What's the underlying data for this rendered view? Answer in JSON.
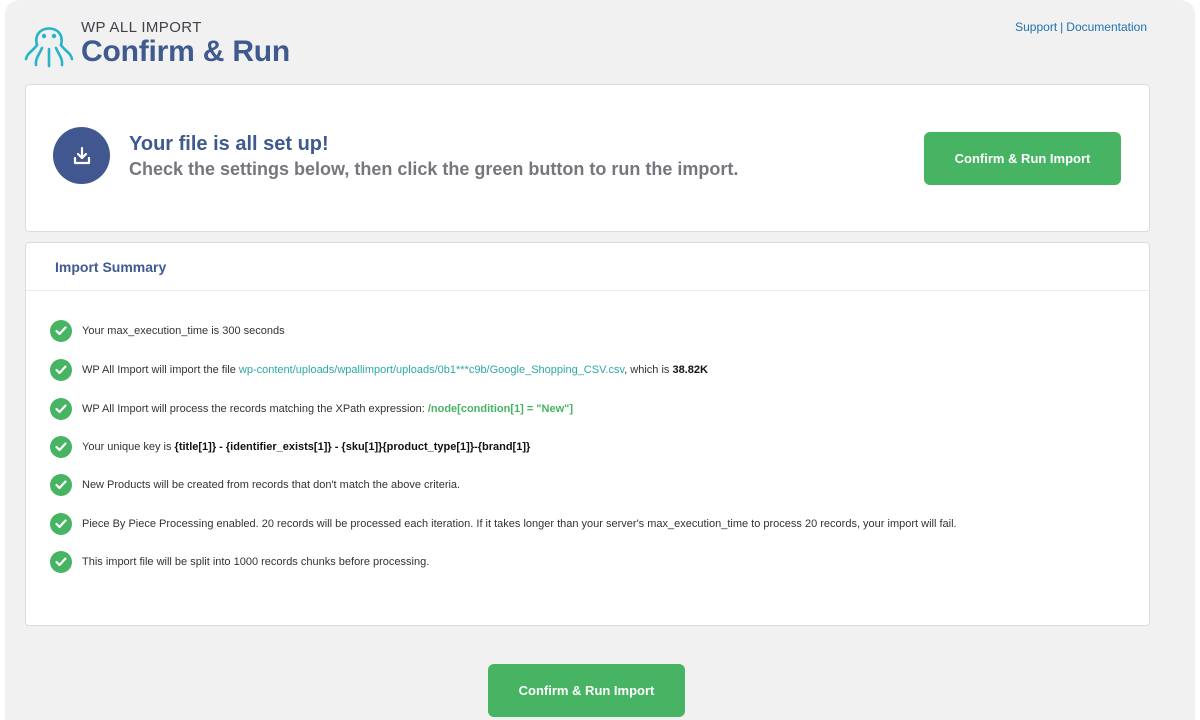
{
  "header": {
    "brand": "WP ALL IMPORT",
    "title": "Confirm & Run",
    "support_label": "Support",
    "separator": "|",
    "docs_label": "Documentation"
  },
  "setup": {
    "title": "Your file is all set up!",
    "subtitle": "Check the settings below, then click the green button to run the import.",
    "button_label": "Confirm & Run Import"
  },
  "summary": {
    "heading": "Import Summary",
    "item1": "Your max_execution_time is 300 seconds",
    "item2_pre": "WP All Import will import the file ",
    "item2_link": "wp-content/uploads/wpallimport/uploads/0b1***c9b/Google_Shopping_CSV.csv",
    "item2_mid": ", which is ",
    "item2_size": "38.82K",
    "item3_pre": "WP All Import will process the records matching the XPath expression: ",
    "item3_xpath": "/node[condition[1] = \"New\"]",
    "item4_pre": "Your unique key is ",
    "item4_key": "{title[1]} - {identifier_exists[1]} - {sku[1]}{product_type[1]}-{brand[1]}",
    "item5": "New Products will be created from records that don't match the above criteria.",
    "item6": "Piece By Piece Processing enabled. 20 records will be processed each iteration. If it takes longer than your server's max_execution_time to process 20 records, your import will fail.",
    "item7": "This import file will be split into 1000 records chunks before processing."
  },
  "footer": {
    "button_label": "Confirm & Run Import"
  },
  "colors": {
    "brand_blue": "#3f5a8f",
    "green": "#46b463",
    "link_teal": "#2aa9a4",
    "link_blue": "#2271b1"
  },
  "icons": {
    "logo": "octopus-logo-icon",
    "download": "download-icon",
    "check": "check-circle-icon"
  }
}
